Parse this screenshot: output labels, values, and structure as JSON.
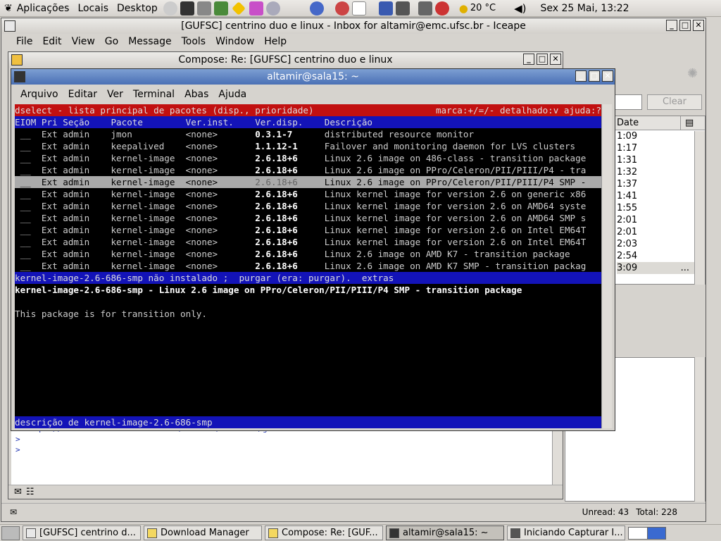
{
  "top_panel": {
    "menus": [
      "Aplicações",
      "Locais",
      "Desktop"
    ],
    "temperature": "20 °C",
    "clock": "Sex 25 Mai, 13:22"
  },
  "iceape": {
    "title": "[GUFSC] centrino duo e linux - Inbox for altamir@emc.ufsc.br - Iceape",
    "menu": [
      "File",
      "Edit",
      "View",
      "Go",
      "Message",
      "Tools",
      "Window",
      "Help"
    ],
    "clear_label": "Clear",
    "date_header": "Date",
    "times": [
      "1:09",
      "1:17",
      "1:31",
      "1:32",
      "1:37",
      "1:41",
      "1:55",
      "2:01",
      "2:01",
      "2:03",
      "2:54",
      "3:09"
    ],
    "ellipsis": "...",
    "unread": "Unread: 43",
    "total": "Total: 228"
  },
  "compose": {
    "title": "Compose: Re: [GUFSC] centrino duo e linux",
    "body_lines": [
      "> https://www.softwarelivre.ufsc.br/mailman/listinfo/gufsc",
      ">",
      ">"
    ]
  },
  "terminal": {
    "title": "altamir@sala15: ~",
    "menu": [
      "Arquivo",
      "Editar",
      "Ver",
      "Terminal",
      "Abas",
      "Ajuda"
    ],
    "header_left": "dselect - lista principal de pacotes (disp., prioridade)",
    "header_right": "marca:+/=/- detalhado:v ajuda:?",
    "columns": [
      "EIOM",
      "Pri",
      "Seção",
      "Pacote",
      "Ver.inst.",
      "Ver.disp.",
      "Descrição"
    ],
    "rows": [
      {
        "mark": "__",
        "pri": "Ext",
        "sec": "admin",
        "pkg": "jmon",
        "inst": "<none>",
        "avail": "0.3.1-7",
        "desc": "distributed resource monitor"
      },
      {
        "mark": "__",
        "pri": "Ext",
        "sec": "admin",
        "pkg": "keepalived",
        "inst": "<none>",
        "avail": "1.1.12-1",
        "desc": "Failover and monitoring daemon for LVS clusters"
      },
      {
        "mark": "__",
        "pri": "Ext",
        "sec": "admin",
        "pkg": "kernel-image",
        "inst": "<none>",
        "avail": "2.6.18+6",
        "desc": "Linux 2.6 image on 486-class - transition package"
      },
      {
        "mark": "__",
        "pri": "Ext",
        "sec": "admin",
        "pkg": "kernel-image",
        "inst": "<none>",
        "avail": "2.6.18+6",
        "desc": "Linux 2.6 image on PPro/Celeron/PII/PIII/P4 - tra"
      },
      {
        "mark": "__",
        "pri": "Ext",
        "sec": "admin",
        "pkg": "kernel-image",
        "inst": "<none>",
        "avail": "2.6.18+6",
        "desc": "Linux 2.6 image on PPro/Celeron/PII/PIII/P4 SMP -",
        "selected": true
      },
      {
        "mark": "__",
        "pri": "Ext",
        "sec": "admin",
        "pkg": "kernel-image",
        "inst": "<none>",
        "avail": "2.6.18+6",
        "desc": "Linux kernel image for version 2.6 on generic x86"
      },
      {
        "mark": "__",
        "pri": "Ext",
        "sec": "admin",
        "pkg": "kernel-image",
        "inst": "<none>",
        "avail": "2.6.18+6",
        "desc": "Linux kernel image for version 2.6 on AMD64 syste"
      },
      {
        "mark": "__",
        "pri": "Ext",
        "sec": "admin",
        "pkg": "kernel-image",
        "inst": "<none>",
        "avail": "2.6.18+6",
        "desc": "Linux kernel image for version 2.6 on AMD64 SMP s"
      },
      {
        "mark": "__",
        "pri": "Ext",
        "sec": "admin",
        "pkg": "kernel-image",
        "inst": "<none>",
        "avail": "2.6.18+6",
        "desc": "Linux kernel image for version 2.6 on Intel EM64T"
      },
      {
        "mark": "__",
        "pri": "Ext",
        "sec": "admin",
        "pkg": "kernel-image",
        "inst": "<none>",
        "avail": "2.6.18+6",
        "desc": "Linux kernel image for version 2.6 on Intel EM64T"
      },
      {
        "mark": "__",
        "pri": "Ext",
        "sec": "admin",
        "pkg": "kernel-image",
        "inst": "<none>",
        "avail": "2.6.18+6",
        "desc": "Linux 2.6 image on AMD K7 - transition package"
      },
      {
        "mark": "__",
        "pri": "Ext",
        "sec": "admin",
        "pkg": "kernel-image",
        "inst": "<none>",
        "avail": "2.6.18+6",
        "desc": "Linux 2.6 image on AMD K7 SMP - transition packag"
      }
    ],
    "status_line": "kernel-image-2.6-686-smp não instalado ;  purgar (era: purgar).  extras",
    "detail_title": "kernel-image-2.6-686-smp - Linux 2.6 image on PPro/Celeron/PII/PIII/P4 SMP - transition package",
    "detail_text": "This package is for transition only.",
    "footer": "descrição de kernel-image-2.6-686-smp"
  },
  "taskbar": {
    "tasks": [
      "[GUFSC] centrino d...",
      "Download Manager",
      "Compose: Re: [GUF...",
      "altamir@sala15: ~",
      "Iniciando Capturar I..."
    ]
  }
}
